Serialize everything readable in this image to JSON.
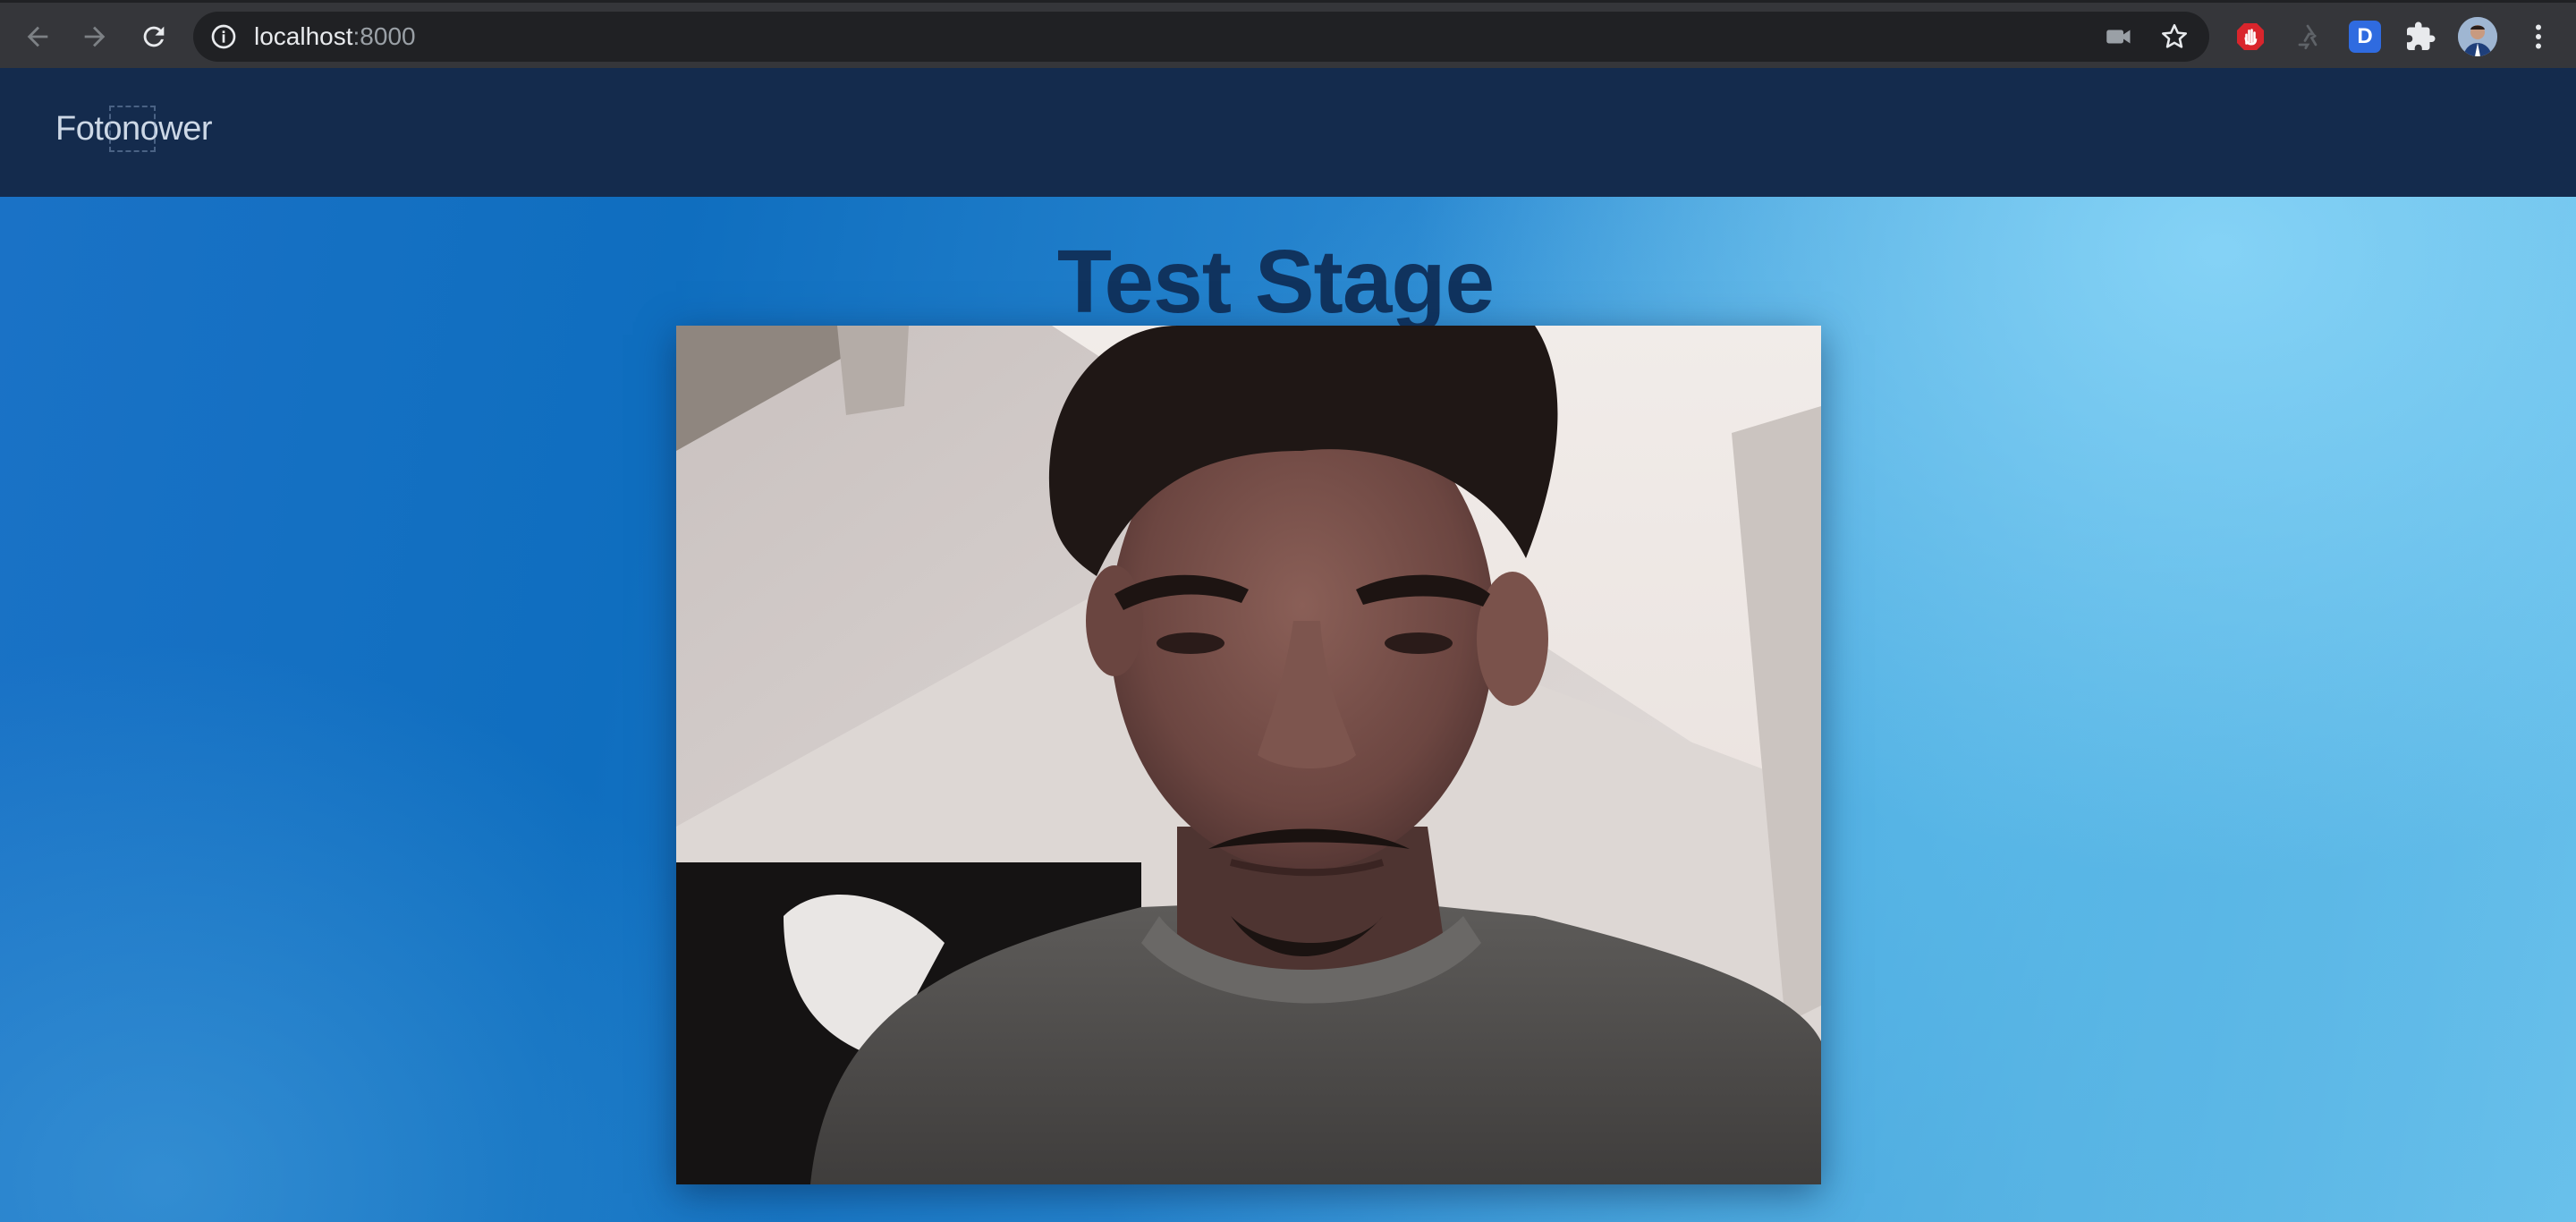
{
  "browser": {
    "url_host": "localhost",
    "url_port": ":8000",
    "icons": {
      "back": "arrow-left-icon",
      "forward": "arrow-right-icon",
      "reload": "reload-icon",
      "site_info": "info-icon",
      "camera": "video-camera-icon",
      "bookmark": "star-icon",
      "extension_adblock": "hand-stop-icon",
      "extension_recycle": "recycle-icon",
      "extension_d_label": "D",
      "extensions": "puzzle-icon",
      "menu": "kebab-menu-icon"
    }
  },
  "header": {
    "logo_text": "Fotonower",
    "background_color": "#142b4d"
  },
  "stage": {
    "title": "Test Stage",
    "title_color": "#10335e"
  }
}
